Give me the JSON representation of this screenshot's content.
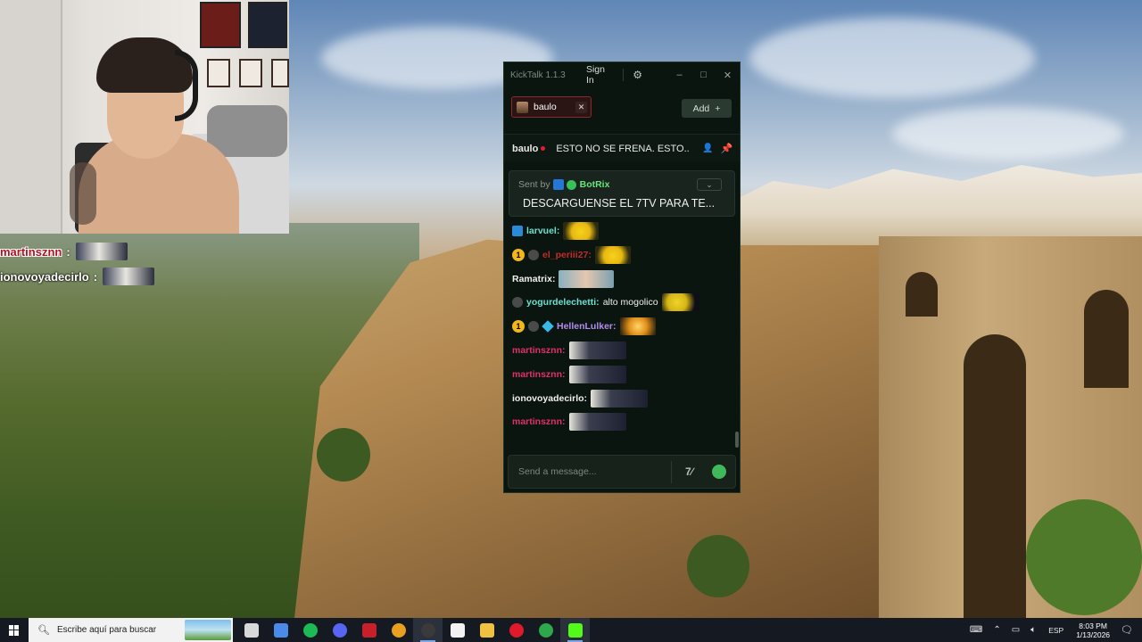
{
  "stream_overlay": {
    "lines": [
      {
        "name": "martinsznn",
        "colon": ":",
        "emote": "emote-dark-face"
      },
      {
        "name": "ionovoyadecirlo",
        "colon": ":",
        "emote": "emote-dark-face"
      }
    ]
  },
  "kicktalk": {
    "app_title": "KickTalk 1.1.3",
    "signin_label": "Sign In",
    "settings_icon": "gear-icon",
    "window_buttons": {
      "minimize": "–",
      "maximize": "□",
      "close": "✕"
    },
    "tab": {
      "label": "baulo",
      "close": "✕"
    },
    "add_label": "Add",
    "add_icon": "+",
    "stream": {
      "user": "baulo",
      "title": "ESTO NO SE FRENA. ESTO..."
    },
    "pinned": {
      "sent_by": "Sent by",
      "author": "BotRix",
      "text": "DESCARGUENSE EL 7TV PARA TE..."
    },
    "messages": [
      {
        "name": "larvuel:",
        "color": "#6de0d0",
        "badges": [
          "badge-7tv"
        ],
        "text": "",
        "emote": "emote-yellow"
      },
      {
        "name": "el_periii27:",
        "color": "#c42a2a",
        "badges": [
          "badge-gold",
          "badge-kick"
        ],
        "text": "",
        "emote": "emote-yellow"
      },
      {
        "name": "Ramatrix:",
        "color": "#f0f0f0",
        "badges": [],
        "text": "",
        "emote": "emote-face"
      },
      {
        "name": "yogurdelechetti:",
        "color": "#6de0d0",
        "badges": [
          "badge-kick"
        ],
        "text": "alto mogolico",
        "emote": "emote-minion"
      },
      {
        "name": "HellenLulker:",
        "color": "#b48cf0",
        "badges": [
          "badge-gold",
          "badge-kick",
          "badge-cube"
        ],
        "text": "",
        "emote": "emote-fire"
      },
      {
        "name": "martinsznn:",
        "color": "#e0306a",
        "badges": [],
        "text": "",
        "emote": "emote-dark-face"
      },
      {
        "name": "martinsznn:",
        "color": "#e0306a",
        "badges": [],
        "text": "",
        "emote": "emote-dark-face"
      },
      {
        "name": "ionovoyadecirlo:",
        "color": "#f0f0f0",
        "badges": [],
        "text": "",
        "emote": "emote-dark-face"
      },
      {
        "name": "martinsznn:",
        "color": "#e0306a",
        "badges": [],
        "text": "",
        "emote": "emote-dark-face"
      }
    ],
    "input": {
      "placeholder": "Send a message...",
      "sevenTV_label": "7∕"
    }
  },
  "taskbar": {
    "search_placeholder": "Escribe aquí para buscar",
    "apps": [
      {
        "name": "task-view-icon",
        "color": "#d8d8d8"
      },
      {
        "name": "copilot-icon",
        "color": "#4a8ae8"
      },
      {
        "name": "spotify-icon",
        "color": "#1db954"
      },
      {
        "name": "discord-icon",
        "color": "#5865f2"
      },
      {
        "name": "game-app-icon",
        "color": "#c8202a"
      },
      {
        "name": "chrome-icon",
        "color": "#e8a020"
      },
      {
        "name": "obs-icon",
        "color": "#3a3a3a"
      },
      {
        "name": "tiktok-live-icon",
        "color": "#f2f2f2"
      },
      {
        "name": "file-explorer-icon",
        "color": "#f0c040"
      },
      {
        "name": "opera-icon",
        "color": "#e01a2a"
      },
      {
        "name": "green-app-icon",
        "color": "#2ea84a"
      },
      {
        "name": "kick-icon",
        "color": "#53fc18"
      }
    ],
    "language": "ESP",
    "time": "8:03 PM",
    "date": "1/13/2026"
  }
}
